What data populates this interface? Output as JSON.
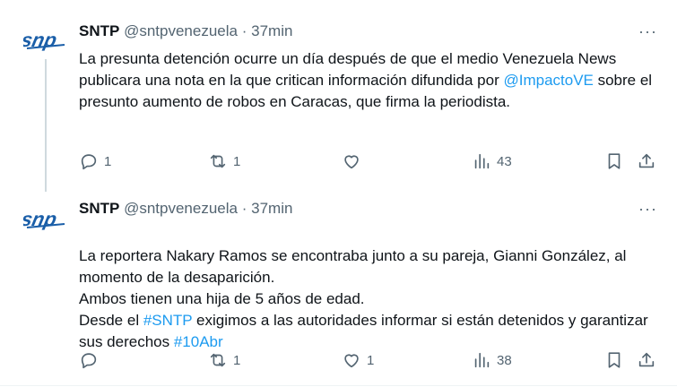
{
  "tweets": [
    {
      "author": "SNTP",
      "handle": "@sntpvenezuela",
      "dot": "·",
      "time": "37min",
      "more": "···",
      "body": [
        {
          "text": "La presunta detención ocurre un día después de que el medio Venezuela News publicara una nota en la que critican información difundida por "
        },
        {
          "text": "@ImpactoVE",
          "link": true
        },
        {
          "text": " sobre el presunto aumento de robos en Caracas, que firma la periodista."
        }
      ],
      "replies": "1",
      "retweets": "1",
      "likes": "",
      "views": "43"
    },
    {
      "author": "SNTP",
      "handle": "@sntpvenezuela",
      "dot": "·",
      "time": "37min",
      "more": "···",
      "body": [
        {
          "text": "La reportera Nakary Ramos se encontraba junto a su pareja, Gianni González, al momento de la desaparición.\nAmbos tienen una hija de 5 años de edad.\nDesde el "
        },
        {
          "text": "#SNTP",
          "link": true
        },
        {
          "text": " exigimos a las autoridades informar si están detenidos y garantizar sus derechos "
        },
        {
          "text": "#10Abr",
          "link": true
        }
      ],
      "replies": "",
      "retweets": "1",
      "likes": "1",
      "views": "38"
    }
  ],
  "colors": {
    "text": "#0f1419",
    "muted": "#536471",
    "link": "#1d9bf0",
    "logo": "#1a5ea8"
  },
  "icons": [
    "snt-logo-icon",
    "more-icon",
    "reply-icon",
    "retweet-icon",
    "like-icon",
    "views-icon",
    "bookmark-icon",
    "share-icon"
  ]
}
